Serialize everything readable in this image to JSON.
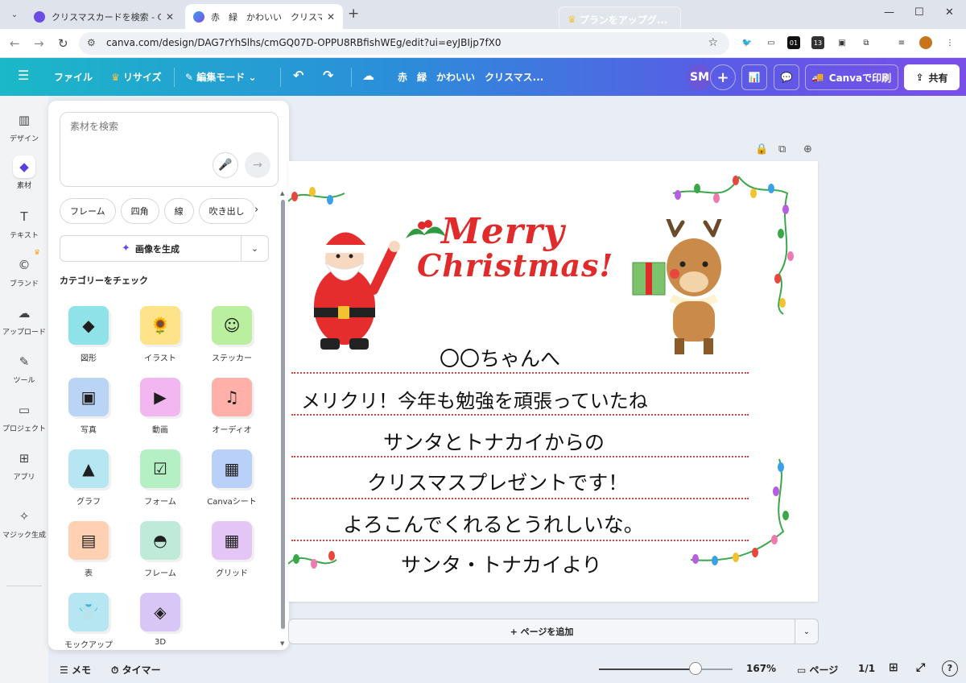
{
  "browser": {
    "tabs": [
      {
        "title": "クリスマスカードを検索 - Canva",
        "active": false
      },
      {
        "title": "赤　緑　かわいい　クリスマスカード",
        "active": true
      }
    ],
    "new_tab": "+",
    "url": "canva.com/design/DAG7rYhSlhs/cmGQ07D-OPPU8RBfishWEg/edit?ui=eyJBIjp7fX0",
    "ext_labels": [
      "01",
      "13"
    ]
  },
  "header": {
    "menu_icon": "menu-icon",
    "file": "ファイル",
    "resize": "リサイズ",
    "edit_mode": "編集モード",
    "doc_title": "赤　緑　かわいい　クリスマス...",
    "upgrade": "プランをアップグ...",
    "avatar": "SM",
    "print": "Canvaで印刷",
    "share": "共有",
    "brand_colors": {
      "crown": "#f5a623",
      "share_bg": "#ffffff"
    }
  },
  "rail": [
    {
      "label": "デザイン",
      "icon": "design-icon"
    },
    {
      "label": "素材",
      "icon": "elements-icon",
      "active": true
    },
    {
      "label": "テキスト",
      "icon": "text-icon"
    },
    {
      "label": "ブランド",
      "icon": "brand-icon"
    },
    {
      "label": "アップロード",
      "icon": "upload-icon"
    },
    {
      "label": "ツール",
      "icon": "tools-icon"
    },
    {
      "label": "プロジェクト",
      "icon": "folder-icon"
    },
    {
      "label": "アプリ",
      "icon": "apps-icon"
    },
    {
      "label": "マジック生成",
      "icon": "magic-icon"
    }
  ],
  "panel": {
    "search_placeholder": "素材を検索",
    "chips": [
      "フレーム",
      "四角",
      "線",
      "吹き出し"
    ],
    "generate": "画像を生成",
    "category_heading": "カテゴリーをチェック",
    "categories": [
      {
        "label": "図形",
        "icon": "shapes-icon",
        "color": "#8fe3e8"
      },
      {
        "label": "イラスト",
        "icon": "sunflower-icon",
        "color": "#ffe38a"
      },
      {
        "label": "ステッカー",
        "icon": "smiley-icon",
        "color": "#b9ef9f"
      },
      {
        "label": "写真",
        "icon": "photo-icon",
        "color": "#b9d4f5"
      },
      {
        "label": "動画",
        "icon": "play-icon",
        "color": "#f2b6f0"
      },
      {
        "label": "オーディオ",
        "icon": "music-icon",
        "color": "#ffb0a8"
      },
      {
        "label": "グラフ",
        "icon": "chart-icon",
        "color": "#b6e6f2"
      },
      {
        "label": "フォーム",
        "icon": "form-icon",
        "color": "#b4f0c3"
      },
      {
        "label": "Canvaシート",
        "icon": "sheet-icon",
        "color": "#b9d0f8"
      },
      {
        "label": "表",
        "icon": "table-icon",
        "color": "#ffd0b2"
      },
      {
        "label": "フレーム",
        "icon": "frame-icon",
        "color": "#bfe9d9"
      },
      {
        "label": "グリッド",
        "icon": "grid-icon",
        "color": "#e3c6f6"
      },
      {
        "label": "モックアップ",
        "icon": "tshirt-icon",
        "color": "#b6e6f2"
      },
      {
        "label": "3D",
        "icon": "cube-icon",
        "color": "#d8c6f6"
      }
    ]
  },
  "card": {
    "merry": "Merry",
    "christmas": "Christmas!",
    "lines": [
      "〇〇ちゃんへ",
      "メリクリ！今年も勉強を頑張っていたね",
      "サンタとトナカイからの",
      "クリスマスプレゼントです！",
      "よろこんでくれるとうれしいな。",
      "サンタ・トナカイより"
    ],
    "accent_red": "#e12a2a",
    "dotted_line_color": "#e0443a"
  },
  "add_page": "+ ページを追加",
  "bottom": {
    "notes": "メモ",
    "timer": "タイマー",
    "zoom": "167%",
    "zoom_level_fraction": 0.72,
    "pages": "ページ",
    "page_count": "1/1"
  }
}
